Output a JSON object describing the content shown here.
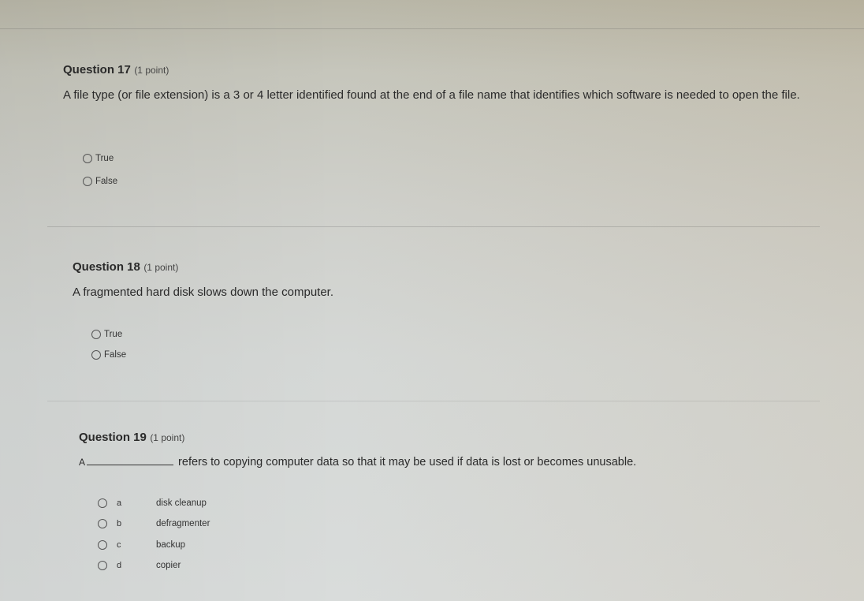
{
  "questions": [
    {
      "number_label": "Question 17",
      "points_label": "(1 point)",
      "text": "A file type (or file extension) is a 3 or 4 letter identified found at the end of a file name that identifies which software is needed to open the file.",
      "options": [
        {
          "label": "True"
        },
        {
          "label": "False"
        }
      ]
    },
    {
      "number_label": "Question 18",
      "points_label": "(1 point)",
      "text": "A fragmented hard disk slows down the computer.",
      "options": [
        {
          "label": "True"
        },
        {
          "label": "False"
        }
      ]
    },
    {
      "number_label": "Question 19",
      "points_label": "(1 point)",
      "text_before_blank": "A",
      "text_after_blank": "refers to copying computer data so that it may be used if data is lost or becomes unusable.",
      "options": [
        {
          "letter": "a",
          "label": "disk cleanup"
        },
        {
          "letter": "b",
          "label": "defragmenter"
        },
        {
          "letter": "c",
          "label": "backup"
        },
        {
          "letter": "d",
          "label": "copier"
        }
      ]
    }
  ]
}
